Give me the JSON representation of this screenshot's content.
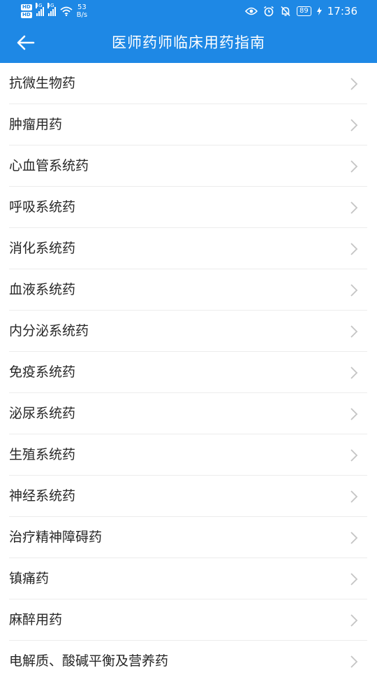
{
  "status_bar": {
    "hd_top": "HD",
    "hd_bottom": "HD",
    "net1": "4G",
    "net2": "4G",
    "speed_value": "53",
    "speed_unit": "B/s",
    "battery": "89",
    "time": "17:36"
  },
  "header": {
    "title": "医师药师临床用药指南"
  },
  "colors": {
    "header_bg": "#1e88e5",
    "text": "#262626",
    "chevron": "#c4c4c4",
    "divider": "#ececec"
  },
  "list": {
    "items": [
      {
        "label": "抗微生物药"
      },
      {
        "label": "肿瘤用药"
      },
      {
        "label": "心血管系统药"
      },
      {
        "label": "呼吸系统药"
      },
      {
        "label": "消化系统药"
      },
      {
        "label": "血液系统药"
      },
      {
        "label": "内分泌系统药"
      },
      {
        "label": "免疫系统药"
      },
      {
        "label": "泌尿系统药"
      },
      {
        "label": "生殖系统药"
      },
      {
        "label": "神经系统药"
      },
      {
        "label": "治疗精神障碍药"
      },
      {
        "label": "镇痛药"
      },
      {
        "label": "麻醉用药"
      },
      {
        "label": "电解质、酸碱平衡及营养药"
      }
    ]
  }
}
